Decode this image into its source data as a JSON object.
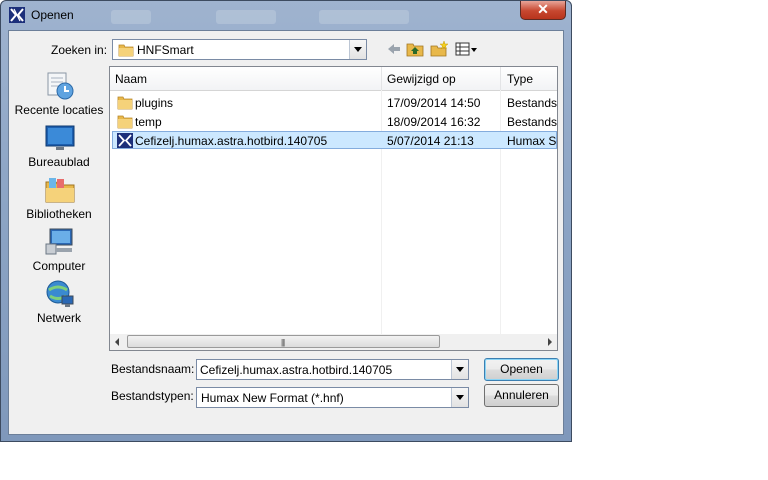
{
  "window": {
    "title": "Openen",
    "close_label": "✕"
  },
  "lookin": {
    "label": "Zoeken in:",
    "value": "HNFSmart"
  },
  "toolbar": {
    "icons": [
      "back-arrow-icon",
      "up-folder-icon",
      "new-folder-icon",
      "view-menu-icon"
    ]
  },
  "places": [
    {
      "label": "Recente locaties",
      "icon": "recent-places-icon"
    },
    {
      "label": "Bureaublad",
      "icon": "desktop-icon"
    },
    {
      "label": "Bibliotheken",
      "icon": "libraries-icon"
    },
    {
      "label": "Computer",
      "icon": "computer-icon"
    },
    {
      "label": "Netwerk",
      "icon": "network-icon"
    }
  ],
  "columns": {
    "name": "Naam",
    "modified": "Gewijzigd op",
    "type": "Type"
  },
  "files": [
    {
      "name": "plugins",
      "modified": "17/09/2014 14:50",
      "type": "Bestandsmap",
      "icon": "folder-icon",
      "selected": false
    },
    {
      "name": "temp",
      "modified": "18/09/2014 16:32",
      "type": "Bestandsmap",
      "icon": "folder-icon",
      "selected": false
    },
    {
      "name": "Cefizelj.humax.astra.hotbird.140705",
      "modified": "5/07/2014 21:13",
      "type": "Humax Settings",
      "icon": "hnf-file-icon",
      "selected": true
    }
  ],
  "filename": {
    "label": "Bestandsnaam:",
    "value": "Cefizelj.humax.astra.hotbird.140705"
  },
  "filetype": {
    "label": "Bestandstypen:",
    "value": "Humax New Format (*.hnf)"
  },
  "buttons": {
    "open": "Openen",
    "cancel": "Annuleren"
  },
  "colors": {
    "selection": "#cce8ff",
    "close_button": "#c7472f",
    "title_bar": "#9fb3cf"
  }
}
